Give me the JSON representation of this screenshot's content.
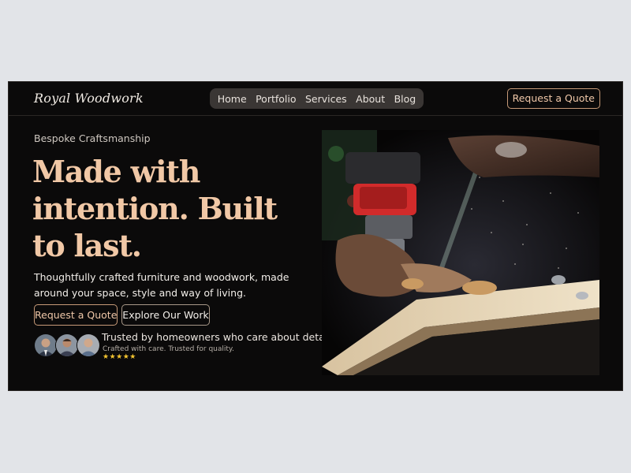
{
  "brand": {
    "name": "Royal Woodwork"
  },
  "nav": {
    "items": [
      {
        "label": "Home"
      },
      {
        "label": "Portfolio"
      },
      {
        "label": "Services"
      },
      {
        "label": "About"
      },
      {
        "label": "Blog"
      }
    ],
    "cta_label": "Request a Quote"
  },
  "hero": {
    "eyebrow": "Bespoke Craftsmanship",
    "headline": "Made with intention. Built to last.",
    "subtext": "Thoughtfully crafted furniture and woodwork, made around your space, style and way of living.",
    "primary_button": "Request a Quote",
    "secondary_button": "Explore Our Work",
    "trust": {
      "title": "Trusted by homeowners who care about detail",
      "subtitle": "Crafted with care. Trusted for quality.",
      "rating": 5,
      "stars": "★★★★★"
    },
    "image_subject": "craftsman-using-router-on-wood"
  },
  "colors": {
    "background": "#0b0a0a",
    "accent": "#f1c8a6",
    "button_border": "#c79a78",
    "star": "#f4c430"
  }
}
